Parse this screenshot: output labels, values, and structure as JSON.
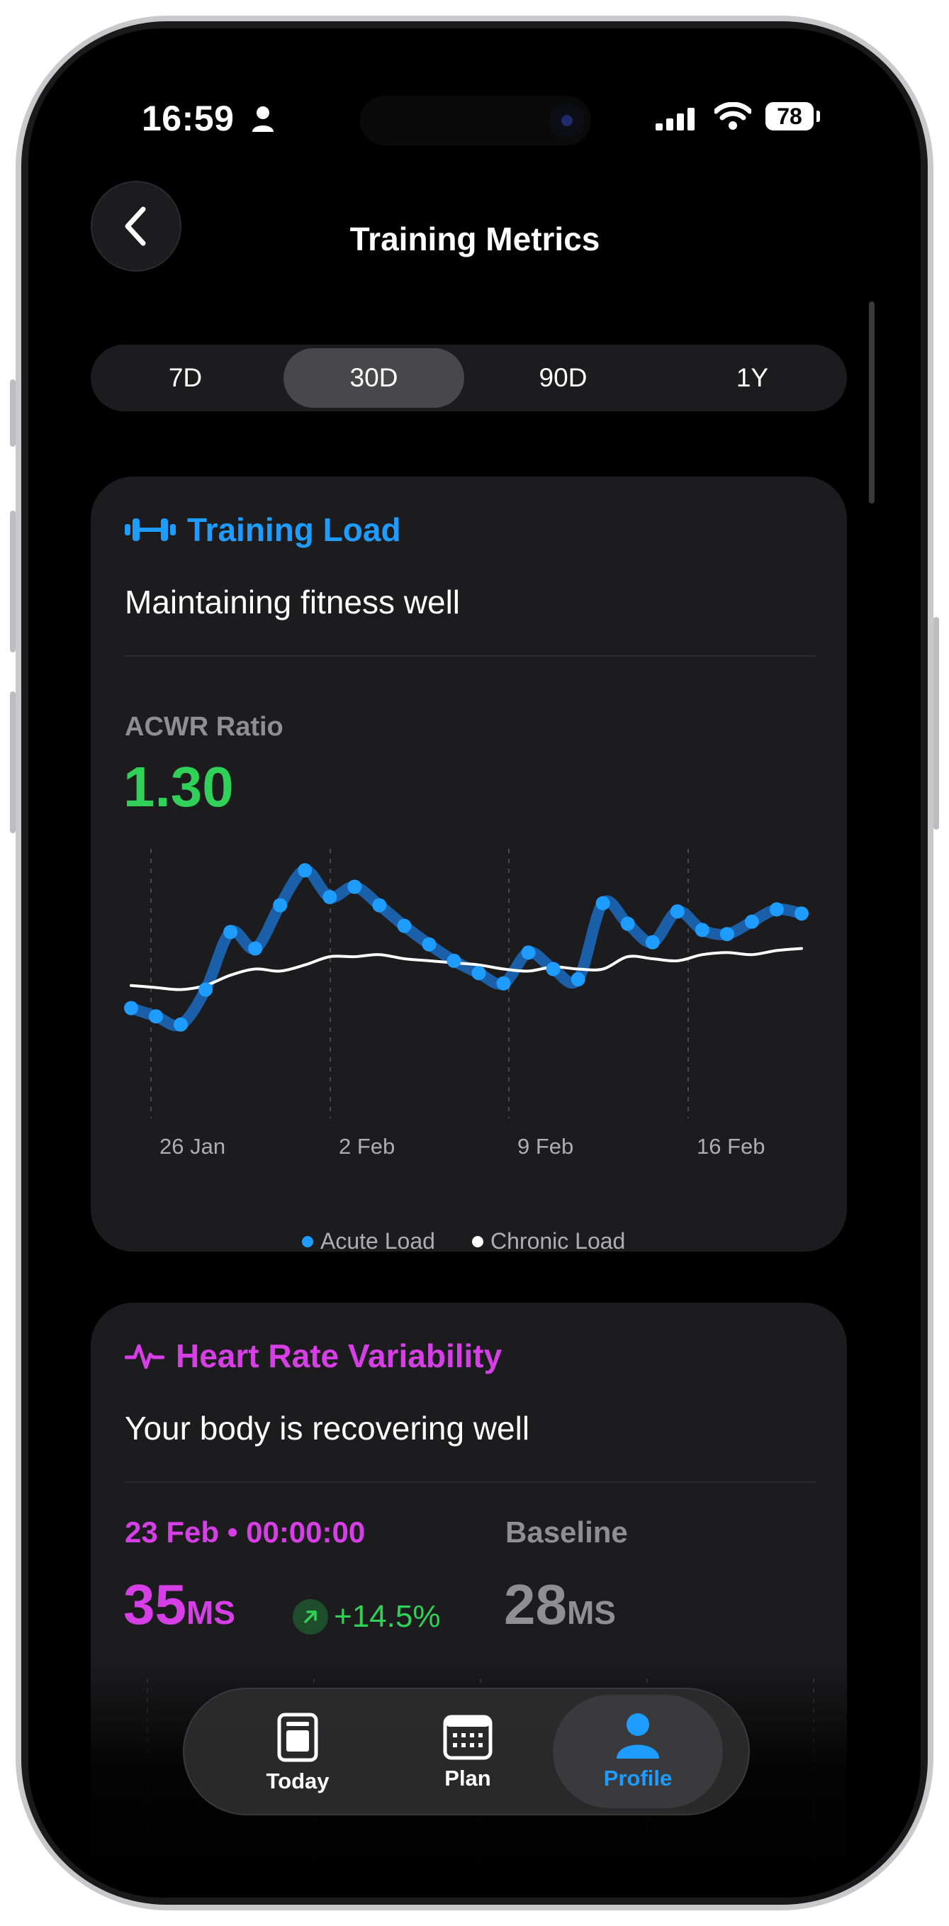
{
  "status_bar": {
    "time": "16:59",
    "battery": "78"
  },
  "header": {
    "title": "Training Metrics"
  },
  "period_tabs": [
    {
      "label": "7D",
      "active": false
    },
    {
      "label": "30D",
      "active": true
    },
    {
      "label": "90D",
      "active": false
    },
    {
      "label": "1Y",
      "active": false
    }
  ],
  "training_load": {
    "title": "Training Load",
    "subtitle": "Maintaining fitness well",
    "metric_label": "ACWR Ratio",
    "metric_value": "1.30",
    "accent": "#1e9cff"
  },
  "chart_data": {
    "type": "line",
    "x_ticks": [
      "26 Jan",
      "2 Feb",
      "9 Feb",
      "16 Feb"
    ],
    "series": [
      {
        "name": "Acute Load",
        "color": "#1e9cff",
        "values": [
          0.26,
          0.22,
          0.18,
          0.35,
          0.63,
          0.55,
          0.76,
          0.93,
          0.8,
          0.85,
          0.76,
          0.66,
          0.57,
          0.49,
          0.43,
          0.38,
          0.53,
          0.45,
          0.4,
          0.77,
          0.67,
          0.58,
          0.73,
          0.64,
          0.62,
          0.68,
          0.74,
          0.72
        ]
      },
      {
        "name": "Chronic Load",
        "color": "#ffffff",
        "values": [
          0.37,
          0.36,
          0.35,
          0.37,
          0.42,
          0.45,
          0.44,
          0.47,
          0.51,
          0.51,
          0.52,
          0.5,
          0.49,
          0.48,
          0.47,
          0.45,
          0.44,
          0.46,
          0.45,
          0.45,
          0.51,
          0.5,
          0.49,
          0.52,
          0.53,
          0.52,
          0.54,
          0.55
        ]
      }
    ],
    "y_range": [
      0,
      1
    ],
    "grid": "vertical dashed",
    "legend": "bottom-center"
  },
  "hrv": {
    "title": "Heart Rate Variability",
    "subtitle": "Your body is recovering well",
    "date": "23 Feb • 00:00:00",
    "value": "35",
    "unit": "MS",
    "change": "+14.5%",
    "baseline_label": "Baseline",
    "baseline_value": "28",
    "baseline_unit": "MS",
    "accent": "#d63fe6"
  },
  "tab_bar": [
    {
      "label": "Today",
      "icon": "today-icon",
      "active": false
    },
    {
      "label": "Plan",
      "icon": "calendar-icon",
      "active": false
    },
    {
      "label": "Profile",
      "icon": "person-icon",
      "active": true
    }
  ]
}
